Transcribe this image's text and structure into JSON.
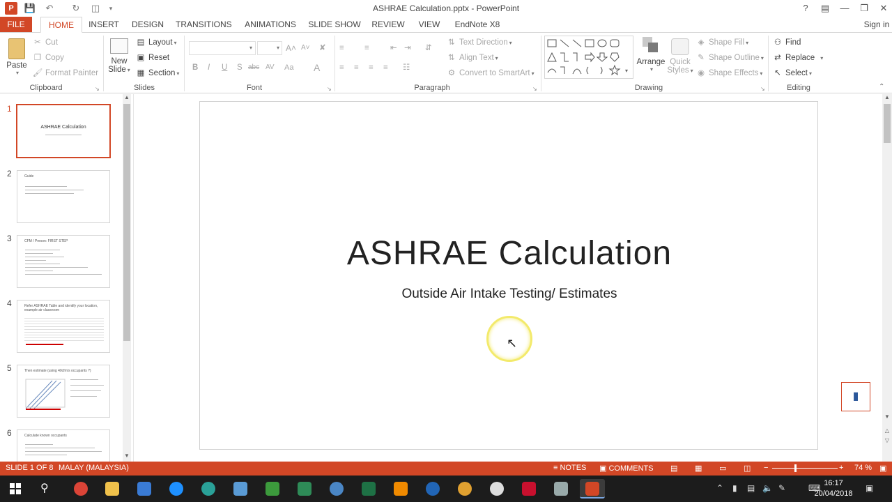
{
  "window": {
    "title": "ASHRAE Calculation.pptx - PowerPoint",
    "sign_in": "Sign in"
  },
  "tabs": [
    "FILE",
    "HOME",
    "INSERT",
    "DESIGN",
    "TRANSITIONS",
    "ANIMATIONS",
    "SLIDE SHOW",
    "REVIEW",
    "VIEW",
    "EndNote X8"
  ],
  "ribbon": {
    "clipboard": {
      "label": "Clipboard",
      "paste": "Paste",
      "cut": "Cut",
      "copy": "Copy",
      "format_painter": "Format Painter"
    },
    "slides": {
      "label": "Slides",
      "new_slide_1": "New",
      "new_slide_2": "Slide",
      "layout": "Layout",
      "reset": "Reset",
      "section": "Section"
    },
    "font": {
      "label": "Font",
      "bold": "B",
      "italic": "I",
      "underline": "U",
      "shadow": "S",
      "strike": "abc",
      "spacing": "AV",
      "case": "Aa",
      "color": "A"
    },
    "paragraph": {
      "label": "Paragraph",
      "text_direction": "Text Direction",
      "align_text": "Align Text",
      "convert_smartart": "Convert to SmartArt"
    },
    "drawing": {
      "label": "Drawing",
      "arrange": "Arrange",
      "quick_styles_1": "Quick",
      "quick_styles_2": "Styles",
      "shape_fill": "Shape Fill",
      "shape_outline": "Shape Outline",
      "shape_effects": "Shape Effects"
    },
    "editing": {
      "label": "Editing",
      "find": "Find",
      "replace": "Replace",
      "select": "Select"
    }
  },
  "thumbnails": [
    {
      "num": "1",
      "title": "ASHRAE Calculation",
      "selected": true
    },
    {
      "num": "2",
      "title": "Guide",
      "selected": false
    },
    {
      "num": "3",
      "title": "CFM / Person: FIRST STEP",
      "selected": false
    },
    {
      "num": "4",
      "title": "Refer ASHRAE Table and identify your location, example air classroom",
      "selected": false
    },
    {
      "num": "5",
      "title": "Then estimate (using 40cfm/s occupants ?)",
      "selected": false
    },
    {
      "num": "6",
      "title": "Calculate known occupants",
      "selected": false
    }
  ],
  "slide": {
    "title": "ASHRAE Calculation",
    "subtitle": "Outside Air Intake Testing/ Estimates"
  },
  "status": {
    "slide_counter": "SLIDE 1 OF 8",
    "language": "MALAY (MALAYSIA)",
    "notes": "NOTES",
    "comments": "COMMENTS",
    "zoom": "74 %"
  },
  "taskbar": {
    "time": "16:17",
    "date": "20/04/2018"
  },
  "colors": {
    "accent": "#d24726",
    "taskbar": "#1c1c1c"
  }
}
